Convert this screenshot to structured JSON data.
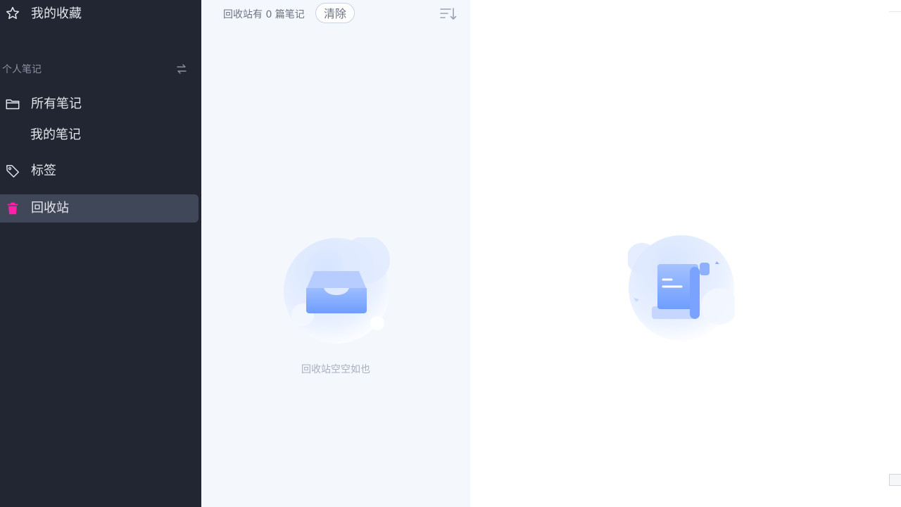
{
  "sidebar": {
    "favorites_label": "我的收藏",
    "section_title": "个人笔记",
    "all_notes_label": "所有笔记",
    "my_notes_label": "我的笔记",
    "tags_label": "标签",
    "trash_label": "回收站",
    "trash_icon_color": "#ff1fa8",
    "active_bg": "#404759"
  },
  "list": {
    "header_text": "回收站有 0 篇笔记",
    "clear_label": "清除",
    "empty_text": "回收站空空如也"
  },
  "icons": {
    "favorites": "star-icon",
    "swap": "swap-icon",
    "all_notes": "folder-icon",
    "tags": "tag-icon",
    "trash": "trash-icon",
    "sort": "sort-icon",
    "empty": "inbox-icon",
    "editor": "document-scroll-icon"
  }
}
